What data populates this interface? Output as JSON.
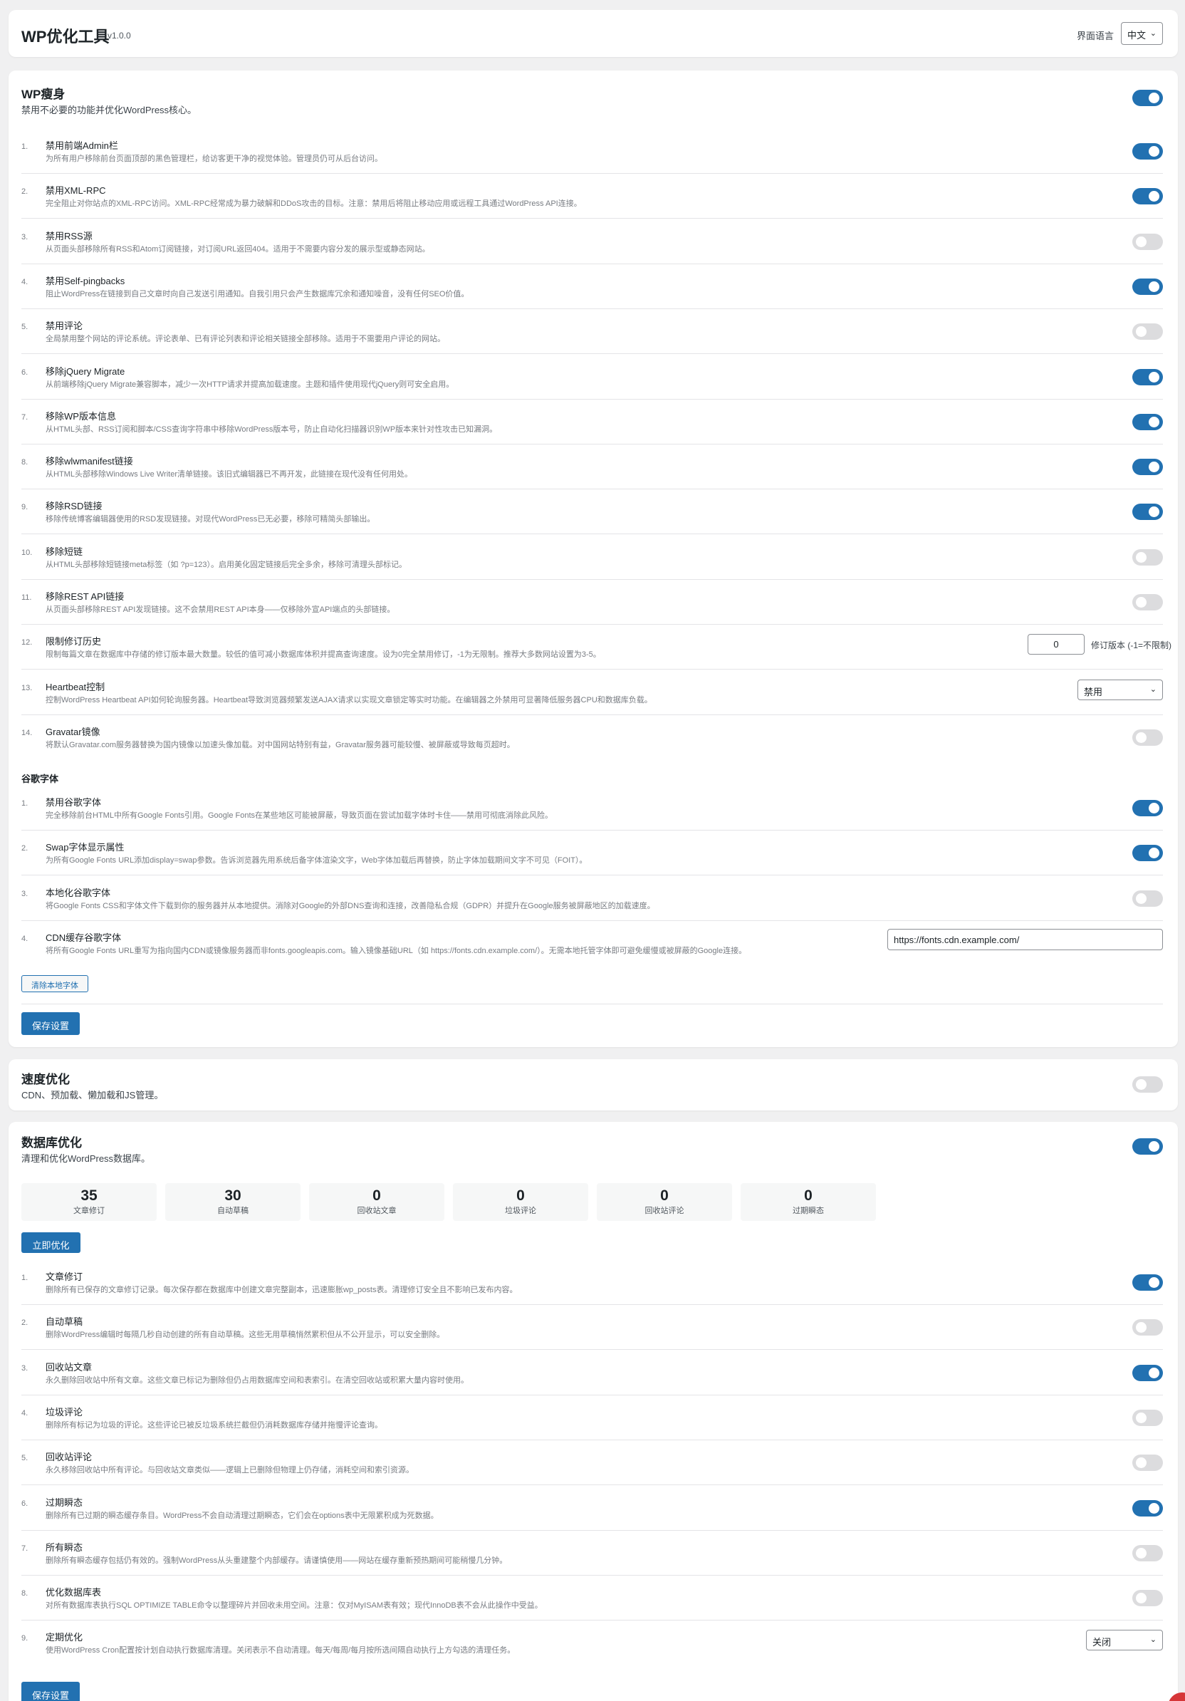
{
  "header": {
    "title": "WP优化工具",
    "version": "v1.0.0",
    "lang_label": "界面语言",
    "lang_value": "中文"
  },
  "slim": {
    "title": "WP瘦身",
    "desc": "禁用不必要的功能并优化WordPress核心。",
    "enabled": true,
    "items": [
      {
        "num": "1.",
        "title": "禁用前端Admin栏",
        "desc": "为所有用户移除前台页面顶部的黑色管理栏，给访客更干净的视觉体验。管理员仍可从后台访问。",
        "on": true
      },
      {
        "num": "2.",
        "title": "禁用XML-RPC",
        "desc": "完全阻止对你站点的XML-RPC访问。XML-RPC经常成为暴力破解和DDoS攻击的目标。注意：禁用后将阻止移动应用或远程工具通过WordPress API连接。",
        "on": true
      },
      {
        "num": "3.",
        "title": "禁用RSS源",
        "desc": "从页面头部移除所有RSS和Atom订阅链接，对订阅URL返回404。适用于不需要内容分发的展示型或静态网站。",
        "on": false
      },
      {
        "num": "4.",
        "title": "禁用Self-pingbacks",
        "desc": "阻止WordPress在链接到自己文章时向自己发送引用通知。自我引用只会产生数据库冗余和通知噪音，没有任何SEO价值。",
        "on": true
      },
      {
        "num": "5.",
        "title": "禁用评论",
        "desc": "全局禁用整个网站的评论系统。评论表单、已有评论列表和评论相关链接全部移除。适用于不需要用户评论的网站。",
        "on": false
      },
      {
        "num": "6.",
        "title": "移除jQuery Migrate",
        "desc": "从前端移除jQuery Migrate兼容脚本，减少一次HTTP请求并提高加载速度。主题和插件使用现代jQuery则可安全启用。",
        "on": true
      },
      {
        "num": "7.",
        "title": "移除WP版本信息",
        "desc": "从HTML头部、RSS订阅和脚本/CSS查询字符串中移除WordPress版本号，防止自动化扫描器识别WP版本来针对性攻击已知漏洞。",
        "on": true
      },
      {
        "num": "8.",
        "title": "移除wlwmanifest链接",
        "desc": "从HTML头部移除Windows Live Writer清单链接。该旧式编辑器已不再开发，此链接在现代没有任何用处。",
        "on": true
      },
      {
        "num": "9.",
        "title": "移除RSD链接",
        "desc": "移除传统博客编辑器使用的RSD发现链接。对现代WordPress已无必要，移除可精简头部输出。",
        "on": true
      },
      {
        "num": "10.",
        "title": "移除短链",
        "desc": "从HTML头部移除短链接meta标签（如 ?p=123）。启用美化固定链接后完全多余，移除可清理头部标记。",
        "on": false
      },
      {
        "num": "11.",
        "title": "移除REST API链接",
        "desc": "从页面头部移除REST API发现链接。这不会禁用REST API本身——仅移除外宣API端点的头部链接。",
        "on": false
      },
      {
        "num": "12.",
        "title": "限制修订历史",
        "desc": "限制每篇文章在数据库中存储的修订版本最大数量。较低的值可减小数据库体积并提高查询速度。设为0完全禁用修订，-1为无限制。推荐大多数网站设置为3-5。",
        "input_value": "0",
        "input_suffix": "修订版本 (-1=不限制)"
      },
      {
        "num": "13.",
        "title": "Heartbeat控制",
        "desc": "控制WordPress Heartbeat API如何轮询服务器。Heartbeat导致浏览器频繁发送AJAX请求以实现文章锁定等实时功能。在编辑器之外禁用可显著降低服务器CPU和数据库负载。",
        "select_value": "禁用"
      },
      {
        "num": "14.",
        "title": "Gravatar镜像",
        "desc": "将默认Gravatar.com服务器替换为国内镜像以加速头像加载。对中国网站特别有益，Gravatar服务器可能较慢、被屏蔽或导致每页超时。",
        "on": false
      }
    ],
    "fonts_heading": "谷歌字体",
    "font_items": [
      {
        "num": "1.",
        "title": "禁用谷歌字体",
        "desc": "完全移除前台HTML中所有Google Fonts引用。Google Fonts在某些地区可能被屏蔽，导致页面在尝试加载字体时卡住——禁用可彻底消除此风险。",
        "on": true
      },
      {
        "num": "2.",
        "title": "Swap字体显示属性",
        "desc": "为所有Google Fonts URL添加display=swap参数。告诉浏览器先用系统后备字体渲染文字，Web字体加载后再替换，防止字体加载期间文字不可见（FOIT）。",
        "on": true
      },
      {
        "num": "3.",
        "title": "本地化谷歌字体",
        "desc": "将Google Fonts CSS和字体文件下载到你的服务器并从本地提供。消除对Google的外部DNS查询和连接，改善隐私合规（GDPR）并提升在Google服务被屏蔽地区的加载速度。",
        "on": false
      },
      {
        "num": "4.",
        "title": "CDN缓存谷歌字体",
        "desc": "将所有Google Fonts URL重写为指向国内CDN或镜像服务器而非fonts.googleapis.com。输入镜像基础URL（如 https://fonts.cdn.example.com/）。无需本地托管字体即可避免缓慢或被屏蔽的Google连接。",
        "input_value": "https://fonts.cdn.example.com/"
      }
    ],
    "clear_fonts_button": "清除本地字体",
    "save_button": "保存设置"
  },
  "speed": {
    "title": "速度优化",
    "desc": "CDN、预加载、懒加载和JS管理。",
    "enabled": false
  },
  "db": {
    "title": "数据库优化",
    "desc": "清理和优化WordPress数据库。",
    "enabled": true,
    "stats": [
      {
        "value": "35",
        "label": "文章修订"
      },
      {
        "value": "30",
        "label": "自动草稿"
      },
      {
        "value": "0",
        "label": "回收站文章"
      },
      {
        "value": "0",
        "label": "垃圾评论"
      },
      {
        "value": "0",
        "label": "回收站评论"
      },
      {
        "value": "0",
        "label": "过期瞬态"
      }
    ],
    "optimize_button": "立即优化",
    "items": [
      {
        "num": "1.",
        "title": "文章修订",
        "desc": "删除所有已保存的文章修订记录。每次保存都在数据库中创建文章完整副本，迅速膨胀wp_posts表。清理修订安全且不影响已发布内容。",
        "on": true
      },
      {
        "num": "2.",
        "title": "自动草稿",
        "desc": "删除WordPress编辑时每隔几秒自动创建的所有自动草稿。这些无用草稿悄然累积但从不公开显示，可以安全删除。",
        "on": false
      },
      {
        "num": "3.",
        "title": "回收站文章",
        "desc": "永久删除回收站中所有文章。这些文章已标记为删除但仍占用数据库空间和表索引。在清空回收站或积累大量内容时使用。",
        "on": true
      },
      {
        "num": "4.",
        "title": "垃圾评论",
        "desc": "删除所有标记为垃圾的评论。这些评论已被反垃圾系统拦截但仍消耗数据库存储并拖慢评论查询。",
        "on": false
      },
      {
        "num": "5.",
        "title": "回收站评论",
        "desc": "永久移除回收站中所有评论。与回收站文章类似——逻辑上已删除但物理上仍存储，消耗空间和索引资源。",
        "on": false
      },
      {
        "num": "6.",
        "title": "过期瞬态",
        "desc": "删除所有已过期的瞬态缓存条目。WordPress不会自动清理过期瞬态，它们会在options表中无限累积成为死数据。",
        "on": true
      },
      {
        "num": "7.",
        "title": "所有瞬态",
        "desc": "删除所有瞬态缓存包括仍有效的。强制WordPress从头重建整个内部缓存。请谨慎使用——网站在缓存重新预热期间可能稍慢几分钟。",
        "on": false
      },
      {
        "num": "8.",
        "title": "优化数据库表",
        "desc": "对所有数据库表执行SQL OPTIMIZE TABLE命令以整理碎片并回收未用空间。注意：仅对MyISAM表有效；现代InnoDB表不会从此操作中受益。",
        "on": false
      },
      {
        "num": "9.",
        "title": "定期优化",
        "desc": "使用WordPress Cron配置按计划自动执行数据库清理。关闭表示不自动清理。每天/每周/每月按所选间隔自动执行上方勾选的清理任务。",
        "select_value": "关闭"
      }
    ],
    "save_button": "保存设置"
  }
}
